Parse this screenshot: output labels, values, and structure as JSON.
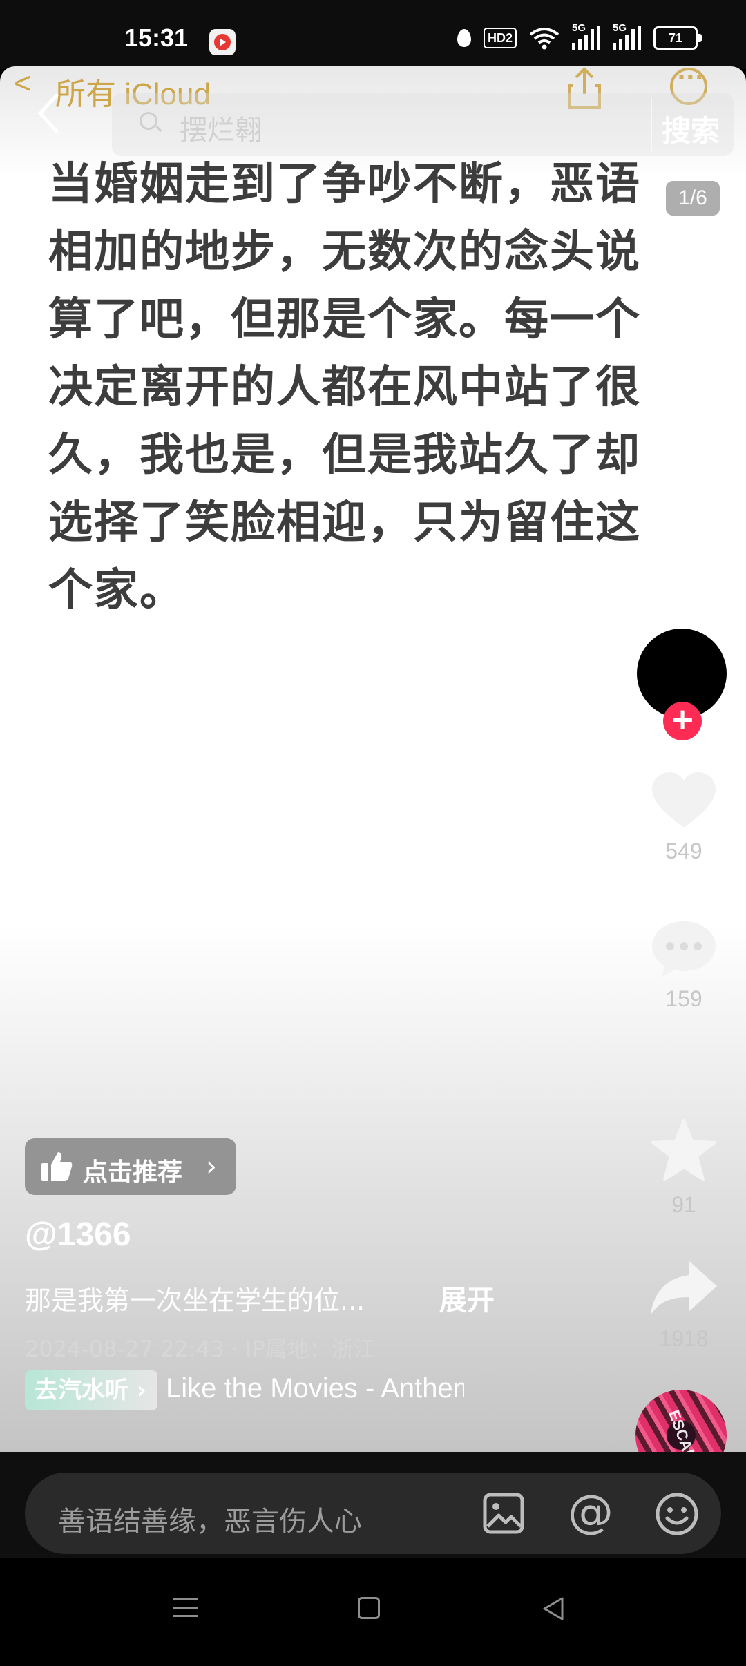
{
  "status_bar": {
    "time": "15:31",
    "hd_badge": "HD2",
    "signal_1": "5G",
    "signal_2": "5G",
    "battery": "71"
  },
  "notes_toolbar": {
    "back_label": "所有 iCloud"
  },
  "search": {
    "placeholder": "摆烂翱",
    "submit_label": "搜索"
  },
  "page_indicator": "1/6",
  "note_body": "当婚姻走到了争吵不断，恶语相加的地步，无数次的念头说算了吧，但那是个家。每一个决定离开的人都在风中站了很久，我也是，但是我站久了却选择了笑脸相迎，只为留住这个家。",
  "actions": {
    "follow_icon": "+",
    "likes": "549",
    "comments": "159",
    "favorites": "91",
    "shares": "1918"
  },
  "recommend": {
    "label": "点击推荐",
    "chevron": "›"
  },
  "post": {
    "author": "@1366",
    "description": "那是我第一次坐在学生的位...",
    "expand_label": "展开",
    "timestamp_location": "2024-08-27 22:43 · IP属地：浙江",
    "music_tag": "去汽水听 ›",
    "music_title": "Like the Movies - Anthem",
    "disc_label": "ESCAPE",
    "progress": {
      "total_segments": 6,
      "current_segment": 1
    }
  },
  "comment_bar": {
    "placeholder": "善语结善缘，恶言伤人心",
    "at_symbol": "@"
  },
  "colors": {
    "accent_notes": "#c89a2e",
    "follow_red": "#fe2c55",
    "text_dark": "#3d3d3d"
  },
  "icons": [
    "back-arrow-icon",
    "search-icon",
    "share-icon",
    "more-icon",
    "like-heart-icon",
    "comment-bubble-icon",
    "favorite-star-icon",
    "share-arrow-icon",
    "thumbs-up-icon",
    "image-icon",
    "at-icon",
    "emoji-icon",
    "menu-icon",
    "home-icon",
    "back-triangle-icon"
  ]
}
